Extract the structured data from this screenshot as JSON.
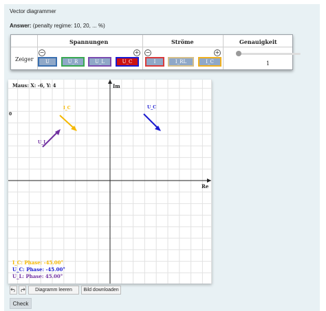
{
  "question": {
    "title": "Vector diagrammer",
    "answer_label": "Answer:",
    "penalty": "(penalty regime: 10, 20, ... %)"
  },
  "table": {
    "col_voltages": "Spannungen",
    "col_currents": "Ströme",
    "col_accuracy": "Genauigkeit",
    "row_label": "Zeiger",
    "voltage_chips": [
      {
        "label": "U",
        "border": "#3a6fb0"
      },
      {
        "label": "U_R",
        "border": "#39a852"
      },
      {
        "label": "U_L",
        "border": "#7b4bb0"
      },
      {
        "label": "U_C",
        "border": "#1a1ad0"
      }
    ],
    "current_chips": [
      {
        "label": "I",
        "border": "#d93a3a"
      },
      {
        "label": "I_RL",
        "border": "#d6c08a"
      },
      {
        "label": "I_C",
        "border": "#f0b020"
      }
    ],
    "accuracy_value": "1",
    "minus": "−",
    "plus": "+"
  },
  "plot": {
    "mouse_text": "Maus: X: -6, Y: 4",
    "axis_im": "Im",
    "axis_re": "Re",
    "tick_zero": "0",
    "vectors": [
      {
        "name": "I_C",
        "color": "#f5b800"
      },
      {
        "name": "U_C",
        "color": "#1a1ad0"
      },
      {
        "name": "U_L",
        "color": "#7030a0"
      }
    ],
    "phases": [
      {
        "text": "I_C: Phase: -45.00°",
        "color": "#f5b800"
      },
      {
        "text": "U_C: Phase: -45.00°",
        "color": "#1a1ad0"
      },
      {
        "text": "U_L: Phase: 45.00°",
        "color": "#7030a0"
      }
    ]
  },
  "toolbar": {
    "undo_icon": "undo-icon",
    "redo_icon": "redo-icon",
    "clear": "Diagramm leeren",
    "download": "Bild downloaden"
  },
  "check_label": "Check"
}
